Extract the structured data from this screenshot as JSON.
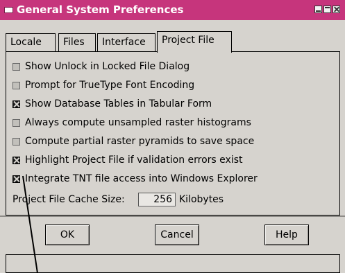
{
  "window": {
    "title": "General System Preferences"
  },
  "tabs": [
    {
      "label": "Locale",
      "active": false
    },
    {
      "label": "Files",
      "active": false
    },
    {
      "label": "Interface",
      "active": false
    },
    {
      "label": "Project File",
      "active": true
    }
  ],
  "options": [
    {
      "label": "Show Unlock in Locked File Dialog",
      "checked": false
    },
    {
      "label": "Prompt for TrueType Font Encoding",
      "checked": false
    },
    {
      "label": "Show Database Tables in Tabular Form",
      "checked": true
    },
    {
      "label": "Always compute unsampled raster histograms",
      "checked": false
    },
    {
      "label": "Compute partial raster pyramids to save space",
      "checked": false
    },
    {
      "label": "Highlight Project File if validation errors exist",
      "checked": true
    },
    {
      "label": "Integrate TNT file access into Windows Explorer",
      "checked": true
    }
  ],
  "cache": {
    "label": "Project File Cache Size:",
    "value": "256",
    "units": "Kilobytes"
  },
  "buttons": {
    "ok": "OK",
    "cancel": "Cancel",
    "help": "Help"
  },
  "colors": {
    "titlebar": "#c6357c",
    "dialog": "#d6d3ce"
  }
}
